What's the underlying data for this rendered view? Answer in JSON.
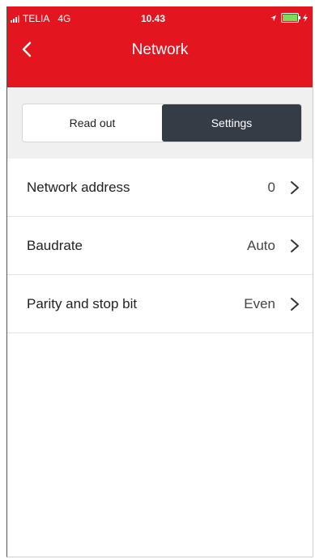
{
  "status_bar": {
    "carrier": "TELIA",
    "network": "4G",
    "time": "10.43",
    "battery_color": "#7ed957"
  },
  "header": {
    "title": "Network",
    "back_icon": "chevron-left-icon",
    "background": "#e3151f"
  },
  "segments": {
    "items": [
      {
        "label": "Read out",
        "active": false
      },
      {
        "label": "Settings",
        "active": true
      }
    ],
    "active_color": "#343c46"
  },
  "settings_list": [
    {
      "label": "Network address",
      "value": "0"
    },
    {
      "label": "Baudrate",
      "value": "Auto"
    },
    {
      "label": "Parity and stop bit",
      "value": "Even"
    }
  ]
}
